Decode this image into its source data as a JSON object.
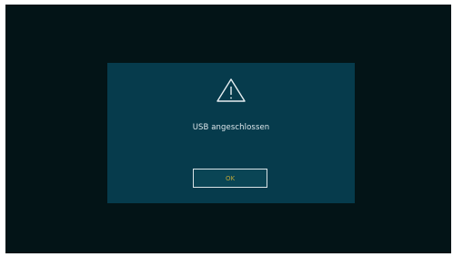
{
  "dialog": {
    "icon": "warning-triangle-icon",
    "message": "USB angeschlossen",
    "ok_label": "OK"
  },
  "colors": {
    "screen_background": "#031417",
    "dialog_background": "#063b4c",
    "text": "#dfe8ec",
    "button_text": "#b8a438",
    "button_border": "#d9e3e6"
  }
}
